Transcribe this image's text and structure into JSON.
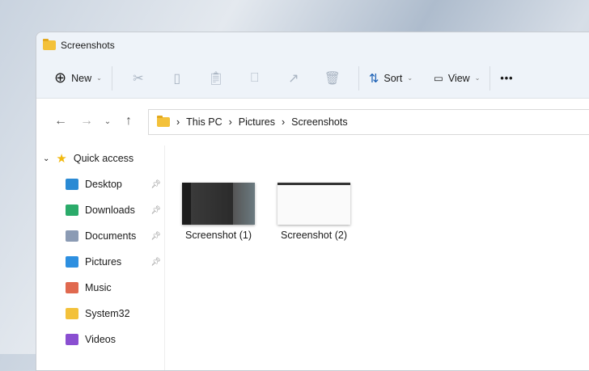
{
  "window": {
    "title": "Screenshots"
  },
  "toolbar": {
    "new_label": "New",
    "sort_label": "Sort",
    "view_label": "View",
    "more_label": "•••"
  },
  "address": {
    "crumbs": [
      "This PC",
      "Pictures",
      "Screenshots"
    ]
  },
  "sidebar": {
    "quick_access": "Quick access",
    "items": [
      {
        "label": "Desktop",
        "pinned": true,
        "icon": "desktop-icon",
        "color": "#2a8ad4"
      },
      {
        "label": "Downloads",
        "pinned": true,
        "icon": "download-icon",
        "color": "#2bab6a"
      },
      {
        "label": "Documents",
        "pinned": true,
        "icon": "documents-icon",
        "color": "#8b9bb4"
      },
      {
        "label": "Pictures",
        "pinned": true,
        "icon": "pictures-icon",
        "color": "#2d8fe0"
      },
      {
        "label": "Music",
        "pinned": false,
        "icon": "music-icon",
        "color": "#e0694f"
      },
      {
        "label": "System32",
        "pinned": false,
        "icon": "folder-icon",
        "color": "#f3c13a"
      },
      {
        "label": "Videos",
        "pinned": false,
        "icon": "videos-icon",
        "color": "#8a4fd1"
      }
    ]
  },
  "files": [
    {
      "name": "Screenshot (1)",
      "theme": "dark"
    },
    {
      "name": "Screenshot (2)",
      "theme": "light"
    }
  ]
}
